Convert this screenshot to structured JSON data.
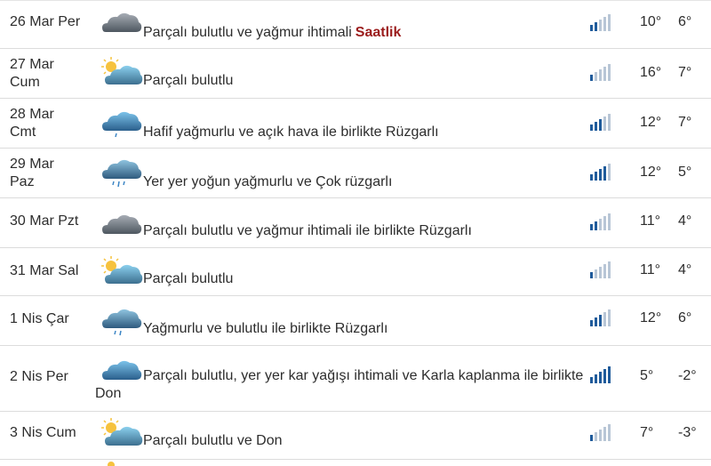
{
  "colors": {
    "link": "#9b1c1c",
    "text": "#2d2d2d",
    "divider": "#dcdcdc",
    "signal_active": "#1f5b9b",
    "signal_inactive": "#b8c6d6"
  },
  "rows": [
    {
      "day": "26 Mar Per",
      "day2": "",
      "icon": "cloudy-icon",
      "desc": "Parçalı bulutlu ve yağmur ihtimali",
      "link": "Saatlik",
      "signal": 2,
      "tmax": "10°",
      "tmin": "6°"
    },
    {
      "day": "27 Mar",
      "day2": "Cum",
      "icon": "partly-sunny-icon",
      "desc": "Parçalı bulutlu",
      "signal": 1,
      "tmax": "16°",
      "tmin": "7°"
    },
    {
      "day": "28 Mar",
      "day2": "Cmt",
      "icon": "light-rain-icon",
      "desc": "Hafif yağmurlu ve açık hava ile birlikte Rüzgarlı",
      "signal": 3,
      "tmax": "12°",
      "tmin": "7°"
    },
    {
      "day": "29 Mar",
      "day2": "Paz",
      "icon": "heavy-rain-icon",
      "desc": "Yer yer yoğun yağmurlu ve Çok rüzgarlı",
      "signal": 4,
      "tmax": "12°",
      "tmin": "5°"
    },
    {
      "day": "30 Mar Pzt",
      "day2": "",
      "icon": "cloudy-icon",
      "desc": "Parçalı bulutlu ve yağmur ihtimali ile birlikte Rüzgarlı",
      "signal": 2,
      "tmax": "11°",
      "tmin": "4°"
    },
    {
      "day": "31 Mar Sal",
      "day2": "",
      "icon": "partly-sunny-icon",
      "desc": "Parçalı bulutlu",
      "signal": 1,
      "tmax": "11°",
      "tmin": "4°"
    },
    {
      "day": "1 Nis Çar",
      "day2": "",
      "icon": "rain-icon",
      "desc": "Yağmurlu ve bulutlu ile birlikte Rüzgarlı",
      "signal": 3,
      "tmax": "12°",
      "tmin": "6°"
    },
    {
      "day": "2 Nis Per",
      "day2": "",
      "icon": "snow-icon",
      "desc": "Parçalı bulutlu, yer yer kar yağışı ihtimali ve Karla kaplanma ile birlikte Don",
      "signal": 5,
      "tmax": "5°",
      "tmin": "-2°"
    },
    {
      "day": "3 Nis Cum",
      "day2": "",
      "icon": "partly-sunny-icon",
      "desc": "Parçalı bulutlu ve Don",
      "signal": 1,
      "tmax": "7°",
      "tmin": "-3°"
    }
  ]
}
